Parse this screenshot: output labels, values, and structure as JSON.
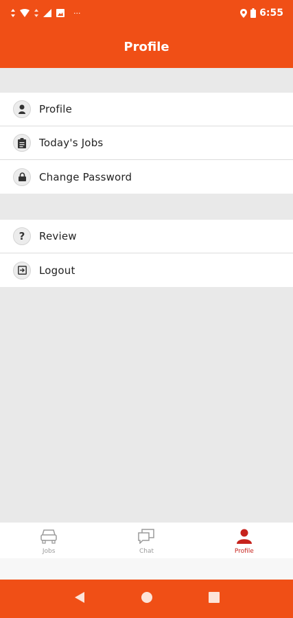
{
  "status_bar": {
    "time": "6:55",
    "more_indicator": "···",
    "icons": [
      "data-arrows-icon",
      "wifi-icon",
      "data-arrows-icon",
      "signal-icon",
      "image-icon",
      "location-icon",
      "battery-icon"
    ]
  },
  "header": {
    "title": "Profile"
  },
  "menu": {
    "group1": [
      {
        "label": "Profile",
        "icon": "person-icon"
      },
      {
        "label": "Today's Jobs",
        "icon": "clipboard-icon"
      },
      {
        "label": "Change Password",
        "icon": "lock-icon"
      }
    ],
    "group2": [
      {
        "label": "Review",
        "icon": "question-icon"
      },
      {
        "label": "Logout",
        "icon": "logout-icon"
      }
    ]
  },
  "bottom_nav": {
    "tabs": [
      {
        "label": "Jobs",
        "icon": "car-icon",
        "active": false
      },
      {
        "label": "Chat",
        "icon": "chat-icon",
        "active": false
      },
      {
        "label": "Profile",
        "icon": "person-icon",
        "active": true
      }
    ]
  },
  "system_nav": {
    "buttons": [
      "back-icon",
      "home-icon",
      "recents-icon"
    ]
  },
  "colors": {
    "primary": "#f04f16",
    "active_tab": "#c6221c",
    "background": "#e9e9e9",
    "inactive_tab": "#9a9a9a"
  }
}
